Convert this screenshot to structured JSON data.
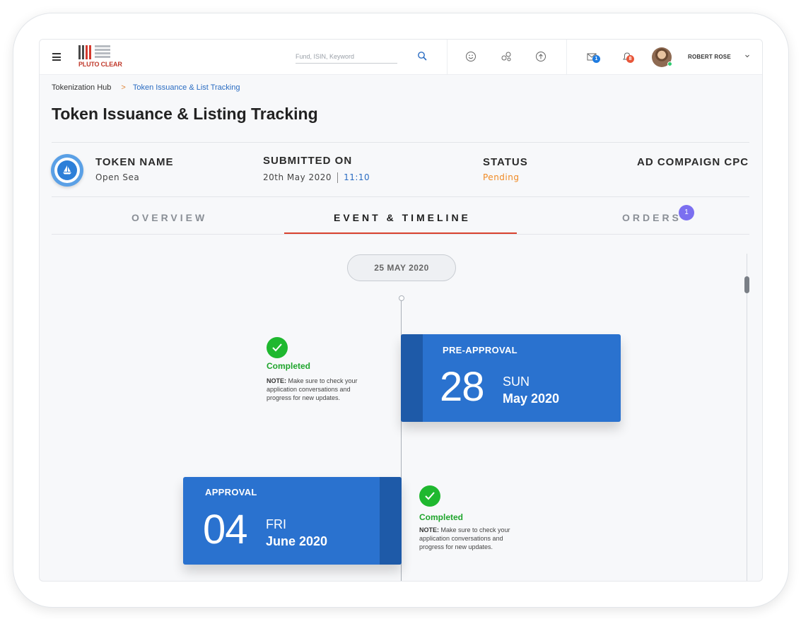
{
  "header": {
    "logo_text": "PLUTO CLEAR",
    "search_placeholder": "Fund, ISIN, Keyword",
    "mail_badge": "1",
    "notification_badge": "8",
    "username": "ROBERT ROSE",
    "colors": {
      "mail_badge": "#1e7be0",
      "notification_badge": "#e8573a"
    },
    "icons": [
      "menu-icon",
      "search-icon",
      "smiley-icon",
      "link-icon",
      "upload-icon",
      "mail-icon",
      "bell-icon",
      "chevron-down-icon"
    ]
  },
  "breadcrumb": {
    "root": "Tokenization Hub",
    "separator": ">",
    "current": "Token Issuance & List Tracking"
  },
  "page_title": "Token Issuance & Listing Tracking",
  "info": {
    "token_name_label": "TOKEN NAME",
    "token_name_value": "Open Sea",
    "submitted_label": "SUBMITTED ON",
    "submitted_date": "20th May 2020",
    "submitted_time": "11:10",
    "status_label": "STATUS",
    "status_value": "Pending",
    "ad_label": "AD COMPAIGN CPC",
    "colors": {
      "pending": "#f08a24",
      "time": "#2a6cc2"
    }
  },
  "tabs": [
    {
      "label": "OVERVIEW",
      "active": false
    },
    {
      "label": "EVENT & TIMELINE",
      "active": true
    },
    {
      "label": "ORDERS",
      "active": false,
      "badge": "1"
    }
  ],
  "timeline": {
    "date_pill": "25 MAY 2020",
    "events": [
      {
        "label": "PRE-APPROVAL",
        "day": "28",
        "weekday": "SUN",
        "month_year": "May 2020",
        "status": "Completed",
        "note_prefix": "NOTE:",
        "note": " Make sure to check your application conversations and progress for new updates."
      },
      {
        "label": "APPROVAL",
        "day": "04",
        "weekday": "FRI",
        "month_year": "June 2020",
        "status": "Completed",
        "note_prefix": "NOTE:",
        "note": " Make sure to check your application conversations and progress for new updates."
      }
    ],
    "colors": {
      "card": "#2a72cf",
      "card_strip": "#1e5aa8",
      "completed": "#1fb82f"
    }
  }
}
